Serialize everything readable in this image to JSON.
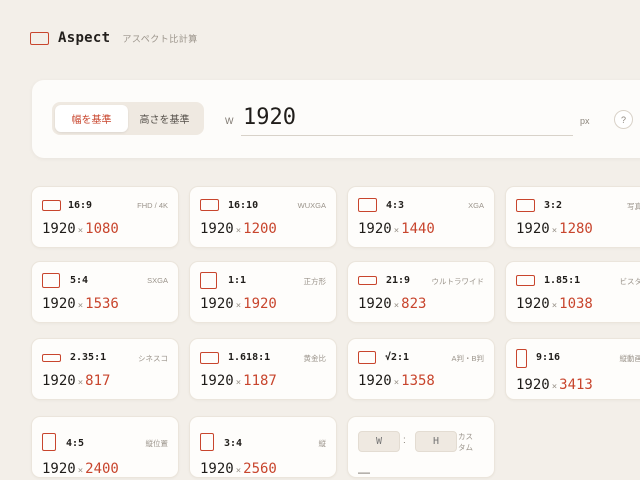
{
  "app": {
    "title": "Aspect",
    "subtitle": "アスペクト比計算"
  },
  "input": {
    "modes": [
      "幅を基準",
      "高さを基準"
    ],
    "active_mode": 0,
    "dim_label": "W",
    "value": "1920",
    "unit": "px",
    "help": "?"
  },
  "colors": {
    "accent": "#c8452d",
    "background": "#f3efe9"
  },
  "cards": [
    {
      "ratio": "16:9",
      "desc": "FHD / 4K",
      "w": "1920",
      "h": "1080"
    },
    {
      "ratio": "16:10",
      "desc": "WUXGA",
      "w": "1920",
      "h": "1200"
    },
    {
      "ratio": "4:3",
      "desc": "XGA",
      "w": "1920",
      "h": "1440"
    },
    {
      "ratio": "3:2",
      "desc": "写真",
      "w": "1920",
      "h": "1280"
    },
    {
      "ratio": "5:4",
      "desc": "SXGA",
      "w": "1920",
      "h": "1536"
    },
    {
      "ratio": "1:1",
      "desc": "正方形",
      "w": "1920",
      "h": "1920"
    },
    {
      "ratio": "21:9",
      "desc": "ウルトラワイド",
      "w": "1920",
      "h": "823"
    },
    {
      "ratio": "1.85:1",
      "desc": "ビスタ",
      "w": "1920",
      "h": "1038"
    },
    {
      "ratio": "2.35:1",
      "desc": "シネスコ",
      "w": "1920",
      "h": "817"
    },
    {
      "ratio": "1.618:1",
      "desc": "黄金比",
      "w": "1920",
      "h": "1187"
    },
    {
      "ratio": "√2:1",
      "desc": "A判・B判",
      "w": "1920",
      "h": "1358"
    },
    {
      "ratio": "9:16",
      "desc": "縦動画",
      "w": "1920",
      "h": "3413"
    },
    {
      "ratio": "4:5",
      "desc": "縦位置",
      "w": "1920",
      "h": "2400"
    },
    {
      "ratio": "3:4",
      "desc": "縦",
      "w": "1920",
      "h": "2560"
    }
  ],
  "custom": {
    "w_placeholder": "W",
    "separator": ":",
    "h_placeholder": "H",
    "label": "カスタム",
    "result": "—"
  }
}
